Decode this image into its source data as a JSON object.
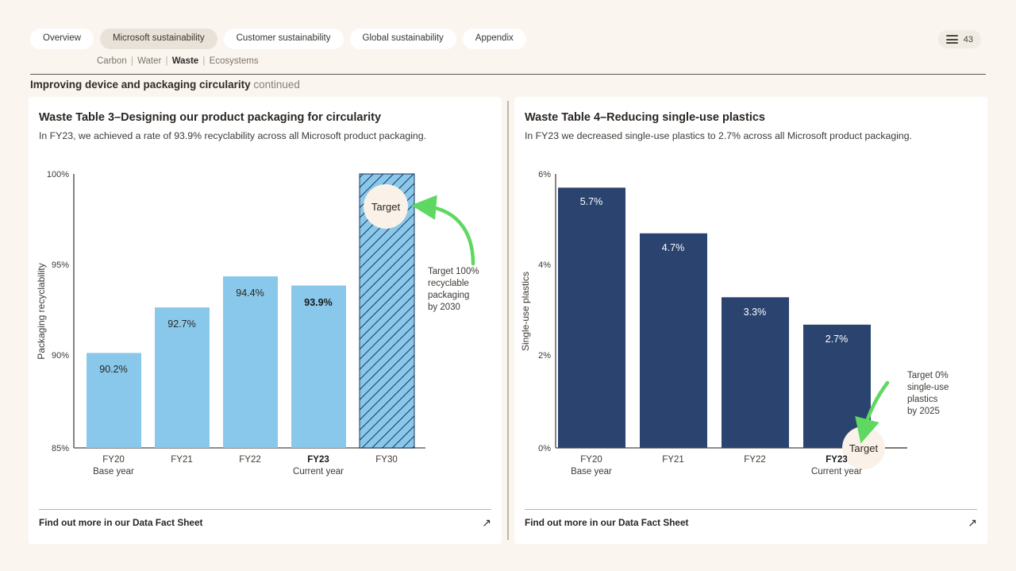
{
  "nav": {
    "tabs": [
      {
        "label": "Overview",
        "active": false
      },
      {
        "label": "Microsoft sustainability",
        "active": true
      },
      {
        "label": "Customer sustainability",
        "active": false
      },
      {
        "label": "Global sustainability",
        "active": false
      },
      {
        "label": "Appendix",
        "active": false
      }
    ],
    "subnav": [
      {
        "label": "Carbon",
        "current": false
      },
      {
        "label": "Water",
        "current": false
      },
      {
        "label": "Waste",
        "current": true
      },
      {
        "label": "Ecosystems",
        "current": false
      }
    ],
    "menu_icon": "hamburger-menu-icon",
    "page_number": "43"
  },
  "page": {
    "title_bold": "Improving device and packaging circularity",
    "title_light": " continued"
  },
  "colors": {
    "background": "#faf5ef",
    "card": "#ffffff",
    "light_blue": "#89c8ea",
    "navy": "#2a446f",
    "green_arrow": "#5ed860",
    "target_badge": "#faf2e8",
    "axis": "#6b6560",
    "active_tab": "#e8e2d8"
  },
  "left_card": {
    "title": "Waste Table 3–Designing our product packaging for circularity",
    "subtitle": "In FY23, we achieved a rate of 93.9% recyclability across all Microsoft product packaging.",
    "annotation": "Target 100% recyclable packaging by 2030",
    "target_badge": "Target",
    "footer_text": "Find out more in our Data Fact Sheet",
    "footer_icon": "external-link-arrow-icon"
  },
  "right_card": {
    "title": "Waste Table 4–Reducing single-use plastics",
    "subtitle": "In FY23 we decreased single-use plastics to 2.7% across all Microsoft product packaging.",
    "annotation": "Target 0% single-use plastics by 2025",
    "target_badge": "Target",
    "footer_text": "Find out more in our Data Fact Sheet",
    "footer_icon": "external-link-arrow-icon"
  },
  "chart_data": [
    {
      "type": "bar",
      "title": "Waste Table 3–Designing our product packaging for circularity",
      "xlabel": "",
      "ylabel": "Packaging recyclability",
      "ylim": [
        85,
        100
      ],
      "yticks": [
        85,
        90,
        95,
        100
      ],
      "ytick_labels": [
        "85%",
        "90%",
        "95%",
        "100%"
      ],
      "grid": false,
      "legend": "none",
      "categories": [
        "FY20",
        "FY21",
        "FY22",
        "FY23",
        "FY30"
      ],
      "category_sublabels": [
        "Base year",
        "",
        "",
        "Current year",
        ""
      ],
      "values": [
        90.2,
        92.7,
        94.4,
        93.9,
        100
      ],
      "value_labels": [
        "90.2%",
        "92.7%",
        "94.4%",
        "93.9%",
        ""
      ],
      "bar_styles": [
        "solid",
        "solid",
        "solid",
        "solid",
        "hatched"
      ],
      "bar_color": "#89c8ea",
      "highlight_index": 3,
      "annotation": "Target 100% recyclable packaging by 2030"
    },
    {
      "type": "bar",
      "title": "Waste Table 4–Reducing single-use plastics",
      "xlabel": "",
      "ylabel": "Single-use plastics",
      "ylim": [
        0,
        6
      ],
      "yticks": [
        0,
        2,
        4,
        6
      ],
      "ytick_labels": [
        "0%",
        "2%",
        "4%",
        "6%"
      ],
      "grid": false,
      "legend": "none",
      "categories": [
        "FY20",
        "FY21",
        "FY22",
        "FY23"
      ],
      "category_sublabels": [
        "Base year",
        "",
        "",
        "Current year"
      ],
      "values": [
        5.7,
        4.7,
        3.3,
        2.7
      ],
      "value_labels": [
        "5.7%",
        "4.7%",
        "3.3%",
        "2.7%"
      ],
      "bar_styles": [
        "solid",
        "solid",
        "solid",
        "solid"
      ],
      "bar_color": "#2a446f",
      "highlight_index": 3,
      "target_value": 0,
      "annotation": "Target 0% single-use plastics by 2025"
    }
  ]
}
